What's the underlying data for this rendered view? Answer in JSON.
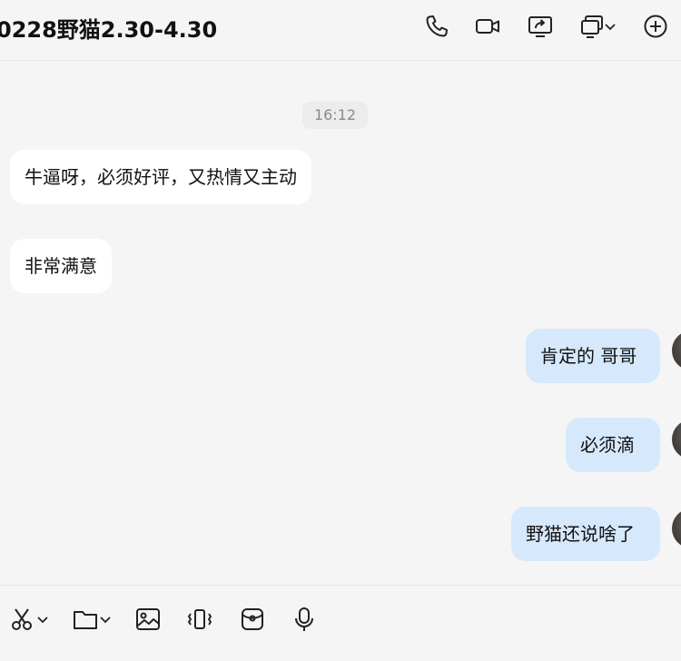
{
  "header": {
    "title": "0228野猫2.30-4.30",
    "icons": [
      "phone-icon",
      "video-camera-icon",
      "screen-share-icon",
      "remote-control-icon",
      "chevron-down-icon",
      "add-circle-icon"
    ]
  },
  "messages": {
    "timestamp": "16:12",
    "items": [
      {
        "direction": "in",
        "text": "牛逼呀，必须好评，又热情又主动"
      },
      {
        "direction": "in",
        "text": "非常满意"
      },
      {
        "direction": "out",
        "text": "肯定的 哥哥"
      },
      {
        "direction": "out",
        "text": "必须滴"
      },
      {
        "direction": "out",
        "text": "野猫还说啥了"
      }
    ]
  },
  "toolbar": {
    "icons": [
      "scissors-icon",
      "chevron-down-icon",
      "folder-icon",
      "chevron-down-icon",
      "image-icon",
      "vibrate-icon",
      "red-packet-icon",
      "microphone-icon"
    ]
  },
  "colors": {
    "background": "#f5f5f5",
    "incoming_bubble": "#ffffff",
    "outgoing_bubble": "#d6e8fc",
    "timestamp_bg": "#ececec",
    "timestamp_text": "#8a8a8a"
  }
}
